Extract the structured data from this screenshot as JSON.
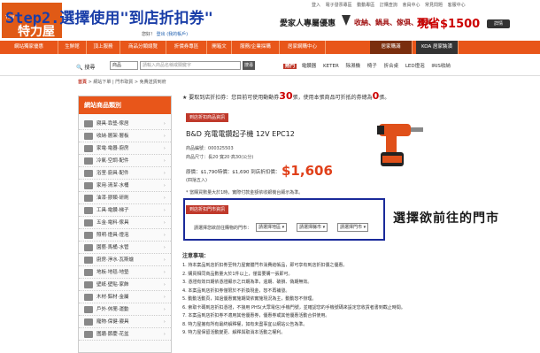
{
  "header": {
    "step_title": "Step2.選擇使用\"到店折扣券\"",
    "logo_text": "特力屋",
    "logo_small": "TLW",
    "hello_text": "您好！",
    "hello_link": "登出",
    "hello_account": "(我的帳戶)",
    "top_links": [
      "登入",
      "電子發票專區",
      "動動專區",
      "訂購查詢",
      "會員中心",
      "常見問題",
      "客服中心"
    ],
    "promo_title": "愛家人專屬優惠",
    "promo_items": "收納、鍋具、傢俱、燈具",
    "promo_cash": "現省$1500",
    "promo_button": "詳情"
  },
  "nav": {
    "items": [
      "網站獨家優惠",
      "生鮮館",
      "頂上服務",
      "商品分類總覽",
      "折價券專區",
      "開箱文",
      "服務/企業採購",
      "居家網購中心"
    ],
    "right_items": [
      "居家購滿",
      "KOA 居家裝潢"
    ]
  },
  "search": {
    "label": "搜尋",
    "category": "商品",
    "placeholder": "請輸入商品名稱或關鍵字",
    "button": "搜尋",
    "hot_label": "熱門",
    "hot_terms": [
      "電鑽器",
      "KETER",
      "除濕機",
      "椅子",
      "折合桌",
      "LED燈泡",
      "IRIS收納"
    ]
  },
  "breadcrumb": {
    "home": "首頁",
    "rest": "> 網站下單 | 門市取貨 > 免費送貨到府"
  },
  "sidebar": {
    "title": "網站商品類別",
    "items": [
      "寢具‧靠墊‧傢居",
      "收納‧層架‧層板",
      "家電‧電器‧廚房",
      "冷氣‧空調‧配件",
      "浴室‧廚具‧配件",
      "家用‧清潔‧水桶",
      "油漆‧膠類‧研刷",
      "工具‧電鑽‧梯子",
      "五金‧電料‧傢具",
      "照明‧燈具‧燈泡",
      "園藝‧馬桶‧水管",
      "廚房‧淨水‧瓦斯爐",
      "地板‧地毯‧地墊",
      "壁紙‧壁貼‧家飾",
      "木材‧鋁材‧金屬",
      "戶外‧休閒‧運動",
      "寵物‧保健‧寢具",
      "圍牆‧節慶‧花盆"
    ]
  },
  "notice": {
    "prefix": "★ 要取到店折扣券：您目前可使用動動券",
    "coupon_count": "30",
    "middle": "張，使用本張商品可折抵的券總為",
    "zero_count": "0",
    "suffix": "張。"
  },
  "product": {
    "section_tag": "到店折扣商品資訊",
    "name": "B&D 充電電鑽起子機 12V EPC12",
    "code_label": "商品編號：",
    "code": "000325503",
    "size_label": "商品尺寸：",
    "size": "長20‧寬20‧高30(公分)",
    "price_line": "原價：$1,790特價：$1,690 到店折扣價：",
    "price_final": "$1,606",
    "unit": "(四捨五入)",
    "note": "* 當購買數量大於1時，實際付款金額依收銀機台顯示為準。"
  },
  "store_select": {
    "section_tag": "到店折扣門市資訊",
    "prompt": "請選擇您欲前往購物的門市：",
    "region": "請選擇地區",
    "city": "請選擇縣市",
    "store": "請選擇門市"
  },
  "hint": "選擇欲前往的門市",
  "rules": {
    "title": "注意事項：",
    "lines": [
      "1. 持本案品到店折扣券至特力屋實體門市消費結帳品，即可享有到店折扣價之優惠。",
      "2. 購買相同商品數量大於1件以上，僅需要購一張即可。",
      "3. 憑證有效日期依憑證顯示之日期為準，逾期、破損、偽期無效。",
      "4. 本案品到店折扣券僅限於不折換現金，恕不再補發。",
      "5. 動動活動頁，如過優惠實施期間依實施現況為主，動動恕不辦理。",
      "6. 索取卡碼到店折扣憑證，不接用 PHS(大眾電信)手機門號，並確認您的手機號碼來設定您收貨者書到截止時間。",
      "7. 本案品到店折扣券不適用其他優惠券，優惠券或其他優惠活動合併使用。",
      "8. 特力屋擁有所有最終解釋權，如有未盡事宜以網站公告為準。",
      "9. 特力屋保留活動變更、解釋與取消本活動之權利。"
    ]
  },
  "colors": {
    "brand": "#e8561a",
    "accent_red": "#c0392b",
    "box_border": "#1a2a9a",
    "title_blue": "#1a3ea8"
  }
}
